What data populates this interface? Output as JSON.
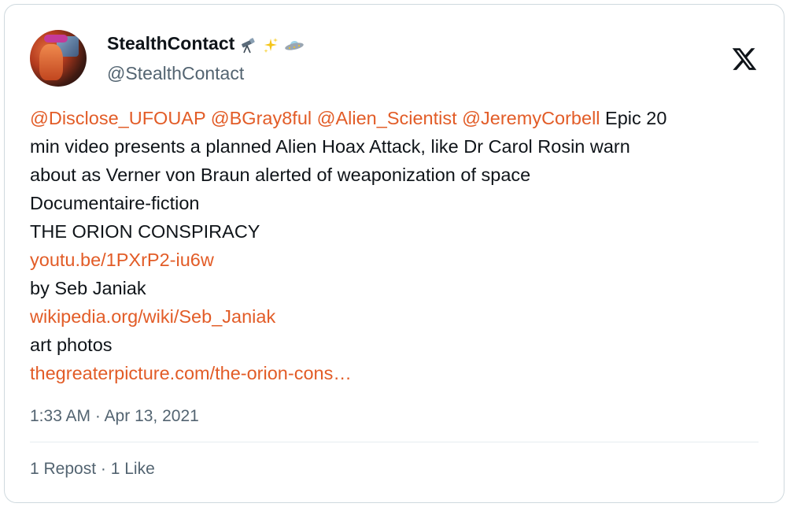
{
  "author": {
    "display_name": "StealthContact",
    "emojis": [
      "telescope-emoji",
      "sparkles-emoji",
      "flying-saucer-emoji"
    ],
    "handle": "@StealthContact"
  },
  "tweet": {
    "mentions": [
      "@Disclose_UFOUAP",
      "@BGray8ful",
      "@Alien_Scientist",
      "@JeremyCorbell"
    ],
    "line1_text": " Epic 20",
    "line2": "min video presents a planned Alien Hoax Attack, like Dr Carol Rosin warn",
    "line3": "about as Verner von Braun alerted of weaponization of space",
    "line4": "Documentaire-fiction",
    "line5": "THE ORION CONSPIRACY",
    "link1": "youtu.be/1PXrP2-iu6w",
    "line7": "by Seb Janiak",
    "link2": "wikipedia.org/wiki/Seb_Janiak",
    "line9": "art photos",
    "link3": "thegreaterpicture.com/the-orion-cons…"
  },
  "timestamp": "1:33 AM · Apr 13, 2021",
  "stats": {
    "reposts": "1 Repost",
    "separator": " · ",
    "likes": "1 Like"
  },
  "colors": {
    "link": "#e25c27",
    "text": "#0f1419",
    "secondary": "#536471",
    "border": "#cfd9de"
  },
  "icons": {
    "brand": "x-logo-icon"
  }
}
